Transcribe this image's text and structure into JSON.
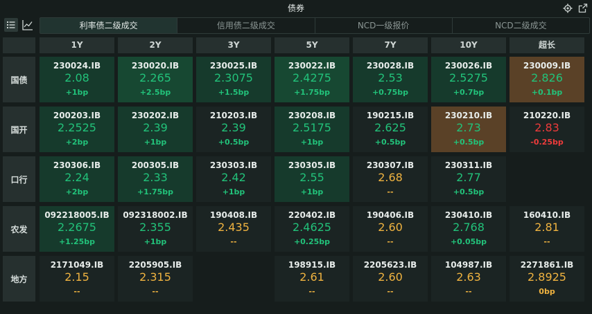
{
  "window": {
    "title": "债券"
  },
  "tabs": [
    "利率债二级成交",
    "信用债二级成交",
    "NCD一级报价",
    "NCD二级成交"
  ],
  "active_tab": 0,
  "columns": [
    "1Y",
    "2Y",
    "3Y",
    "5Y",
    "7Y",
    "10Y",
    "超长"
  ],
  "colors": {
    "up_green": "#22c27a",
    "down_red": "#ee3b3b",
    "neutral_orange": "#f0b340",
    "bg_strong_green": "#174832",
    "bg_green": "#163a2c",
    "bg_dark": "#1b2423",
    "bg_brown": "#5a4127"
  },
  "rows": [
    {
      "label": "国债",
      "cells": [
        {
          "code": "230024.IB",
          "yield": "2.08",
          "change": "+1bp",
          "tone": "up",
          "bg": "green"
        },
        {
          "code": "230020.IB",
          "yield": "2.265",
          "change": "+2.5bp",
          "tone": "up",
          "bg": "strong_green"
        },
        {
          "code": "230025.IB",
          "yield": "2.3075",
          "change": "+1.5bp",
          "tone": "up",
          "bg": "green"
        },
        {
          "code": "230022.IB",
          "yield": "2.4275",
          "change": "+1.75bp",
          "tone": "up",
          "bg": "strong_green"
        },
        {
          "code": "230028.IB",
          "yield": "2.53",
          "change": "+0.75bp",
          "tone": "up",
          "bg": "green"
        },
        {
          "code": "230026.IB",
          "yield": "2.5275",
          "change": "+0.7bp",
          "tone": "up",
          "bg": "green"
        },
        {
          "code": "230009.IB",
          "yield": "2.826",
          "change": "+0.1bp",
          "tone": "up",
          "bg": "brown"
        }
      ]
    },
    {
      "label": "国开",
      "cells": [
        {
          "code": "200203.IB",
          "yield": "2.2525",
          "change": "+2bp",
          "tone": "up",
          "bg": "green"
        },
        {
          "code": "230202.IB",
          "yield": "2.39",
          "change": "+1bp",
          "tone": "up",
          "bg": "green"
        },
        {
          "code": "210203.IB",
          "yield": "2.39",
          "change": "+0.5bp",
          "tone": "up",
          "bg": "dark"
        },
        {
          "code": "230208.IB",
          "yield": "2.5175",
          "change": "+1bp",
          "tone": "up",
          "bg": "green"
        },
        {
          "code": "190215.IB",
          "yield": "2.625",
          "change": "+0.5bp",
          "tone": "up",
          "bg": "dark"
        },
        {
          "code": "230210.IB",
          "yield": "2.73",
          "change": "+0.5bp",
          "tone": "up",
          "bg": "brown"
        },
        {
          "code": "210220.IB",
          "yield": "2.83",
          "change": "-0.25bp",
          "tone": "down",
          "bg": "dark"
        }
      ]
    },
    {
      "label": "口行",
      "cells": [
        {
          "code": "230306.IB",
          "yield": "2.24",
          "change": "+2bp",
          "tone": "up",
          "bg": "green"
        },
        {
          "code": "200305.IB",
          "yield": "2.33",
          "change": "+1.75bp",
          "tone": "up",
          "bg": "green"
        },
        {
          "code": "230303.IB",
          "yield": "2.42",
          "change": "+1bp",
          "tone": "up",
          "bg": "dark"
        },
        {
          "code": "230305.IB",
          "yield": "2.55",
          "change": "+1bp",
          "tone": "up",
          "bg": "green"
        },
        {
          "code": "230307.IB",
          "yield": "2.68",
          "change": "--",
          "tone": "neutral",
          "bg": "dark"
        },
        {
          "code": "230311.IB",
          "yield": "2.77",
          "change": "+0.5bp",
          "tone": "up",
          "bg": "dark"
        },
        null
      ]
    },
    {
      "label": "农发",
      "cells": [
        {
          "code": "092218005.IB",
          "yield": "2.2675",
          "change": "+1.25bp",
          "tone": "up",
          "bg": "green"
        },
        {
          "code": "092318002.IB",
          "yield": "2.355",
          "change": "+1bp",
          "tone": "up",
          "bg": "dark"
        },
        {
          "code": "190408.IB",
          "yield": "2.435",
          "change": "--",
          "tone": "neutral",
          "bg": "dark"
        },
        {
          "code": "220402.IB",
          "yield": "2.4625",
          "change": "+0.25bp",
          "tone": "up",
          "bg": "dark"
        },
        {
          "code": "190406.IB",
          "yield": "2.60",
          "change": "--",
          "tone": "neutral",
          "bg": "dark"
        },
        {
          "code": "230410.IB",
          "yield": "2.768",
          "change": "+0.05bp",
          "tone": "up",
          "bg": "dark"
        },
        {
          "code": "160410.IB",
          "yield": "2.81",
          "change": "--",
          "tone": "neutral",
          "bg": "dark"
        }
      ]
    },
    {
      "label": "地方",
      "cells": [
        {
          "code": "2171049.IB",
          "yield": "2.15",
          "change": "--",
          "tone": "neutral",
          "bg": "dark"
        },
        {
          "code": "2205905.IB",
          "yield": "2.315",
          "change": "--",
          "tone": "neutral",
          "bg": "dark"
        },
        null,
        {
          "code": "198915.IB",
          "yield": "2.61",
          "change": "--",
          "tone": "neutral",
          "bg": "dark"
        },
        {
          "code": "2205623.IB",
          "yield": "2.60",
          "change": "--",
          "tone": "neutral",
          "bg": "dark"
        },
        {
          "code": "104987.IB",
          "yield": "2.63",
          "change": "--",
          "tone": "neutral",
          "bg": "dark"
        },
        {
          "code": "2271861.IB",
          "yield": "2.8925",
          "change": "0bp",
          "tone": "neutral",
          "bg": "dark"
        }
      ]
    }
  ]
}
